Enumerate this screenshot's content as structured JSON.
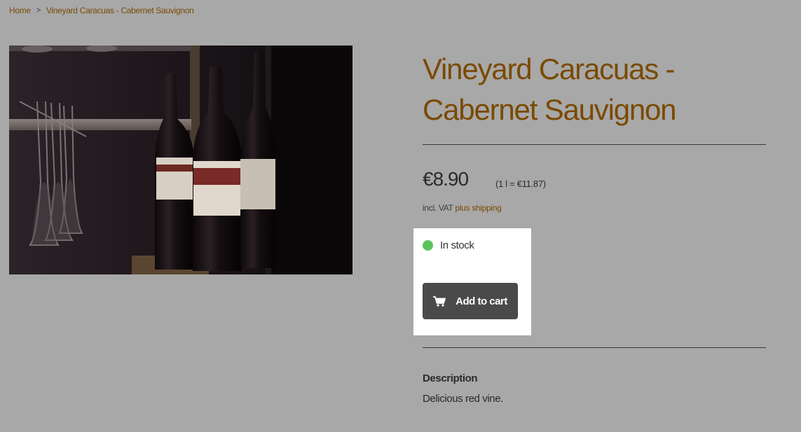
{
  "breadcrumb": {
    "items": [
      "Home",
      "Vineyard Caracuas - Cabernet Sauvignon"
    ],
    "separator": ">"
  },
  "product": {
    "title": "Vineyard Caracuas - Cabernet Sauvignon",
    "price": "€8.90",
    "unit_price": "(1 l = €11.87)",
    "vat_label": "incl. VAT",
    "shipping_link": "plus shipping",
    "stock_status": "In stock",
    "add_to_cart_label": "Add to cart",
    "description_heading": "Description",
    "description_text": "Delicious red vine."
  },
  "colors": {
    "accent": "#7a4a00",
    "stock_ok": "#5cc35c",
    "button_bg": "#4a4a4a",
    "overlay": "#a8a8a8"
  },
  "icons": {
    "cart": "shopping-cart-icon",
    "breadcrumb_separator": "chevron-right-icon",
    "stock": "status-dot-icon"
  }
}
